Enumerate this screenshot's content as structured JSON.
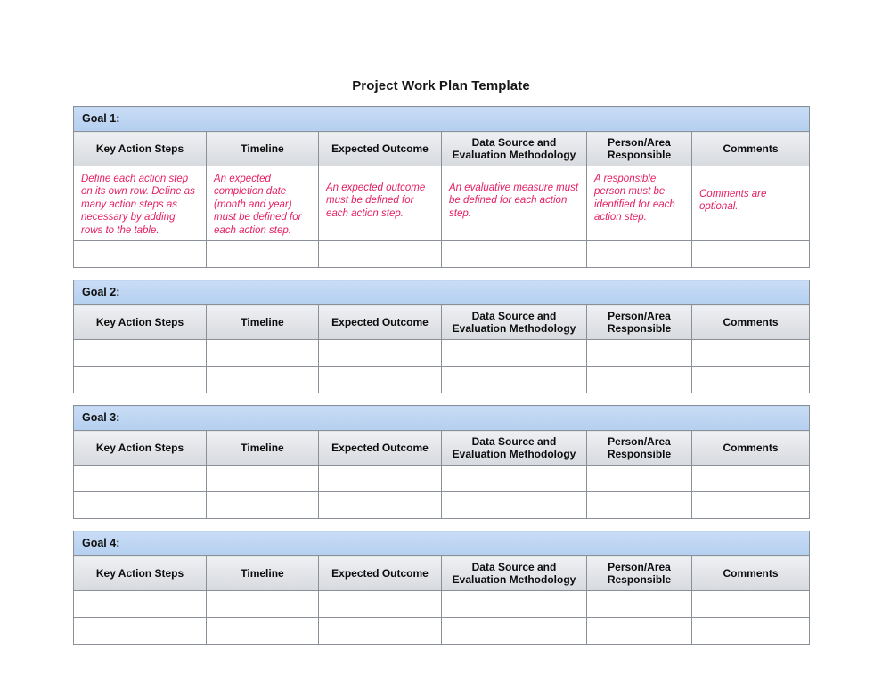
{
  "document": {
    "title": "Project Work Plan Template",
    "background_color": "#ffffff",
    "accent_goal_bar_color": "#bdd5f2",
    "column_header_color": "#e3e5e9",
    "instruction_text_color": "#e61e64",
    "border_color": "#8a8f98"
  },
  "columns": [
    {
      "key": "key_action_steps",
      "label": "Key Action Steps"
    },
    {
      "key": "timeline",
      "label": "Timeline"
    },
    {
      "key": "expected_outcome",
      "label": "Expected Outcome"
    },
    {
      "key": "data_source",
      "label_line1": "Data Source and",
      "label_line2": "Evaluation Methodology"
    },
    {
      "key": "person_area",
      "label_line1": "Person/Area",
      "label_line2": "Responsible"
    },
    {
      "key": "comments",
      "label": "Comments"
    }
  ],
  "goals": [
    {
      "banner": "Goal 1:",
      "rows": [
        {
          "type": "instructions",
          "cells": [
            "Define each action step on its own row. Define as many action steps as necessary by adding rows to the table.",
            "An expected completion date (month and year) must be defined for each action step.",
            "An expected outcome must be defined for each action step.",
            "An evaluative measure must be defined for each action step.",
            "A responsible person must be identified for each action step.",
            "Comments are optional."
          ]
        },
        {
          "type": "empty",
          "cells": [
            "",
            "",
            "",
            "",
            "",
            ""
          ]
        }
      ]
    },
    {
      "banner": "Goal 2:",
      "rows": [
        {
          "type": "empty",
          "cells": [
            "",
            "",
            "",
            "",
            "",
            ""
          ]
        },
        {
          "type": "empty",
          "cells": [
            "",
            "",
            "",
            "",
            "",
            ""
          ]
        }
      ]
    },
    {
      "banner": "Goal 3:",
      "rows": [
        {
          "type": "empty",
          "cells": [
            "",
            "",
            "",
            "",
            "",
            ""
          ]
        },
        {
          "type": "empty",
          "cells": [
            "",
            "",
            "",
            "",
            "",
            ""
          ]
        }
      ]
    },
    {
      "banner": "Goal 4:",
      "rows": [
        {
          "type": "empty",
          "cells": [
            "",
            "",
            "",
            "",
            "",
            ""
          ]
        },
        {
          "type": "empty",
          "cells": [
            "",
            "",
            "",
            "",
            "",
            ""
          ]
        }
      ]
    }
  ]
}
